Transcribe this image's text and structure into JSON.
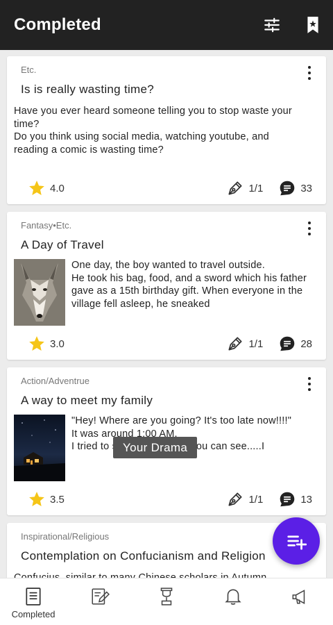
{
  "header": {
    "title": "Completed",
    "background": "#222222",
    "icons": [
      "tune-icon",
      "bookmark-icon"
    ]
  },
  "posts": [
    {
      "category": "Etc.",
      "title": "Is is really wasting time?",
      "excerpt": "Have you ever heard someone telling you to stop waste your time?\nDo you think using social media, watching youtube, and reading a comic is wasting time?",
      "rating": "4.0",
      "episodes": "1/1",
      "comments": "33"
    },
    {
      "category": "Fantasy•Etc.",
      "title": "A Day of Travel",
      "excerpt": "One day, the boy wanted to travel outside.\nHe took his bag, food, and a sword which his father gave as a 15th birthday gift. When everyone in the village fell asleep, he sneaked",
      "thumbnail": "wolf-image",
      "rating": "3.0",
      "episodes": "1/1",
      "comments": "28"
    },
    {
      "category": "Action/Adventrue",
      "title": "A way to meet my family",
      "excerpt": "\"Hey! Where are you going? It's too late now!!!!\"\nIt was around 1:00 AM.\nI tried to sneak out but as you can see.....I",
      "thumbnail": "night-house-image",
      "rating": "3.5",
      "episodes": "1/1",
      "comments": "13"
    },
    {
      "category": "Inspirational/Religious",
      "title": "Contemplation on Confucianism and Religion",
      "excerpt": "Confucius, similar to many Chinese scholars in Autumn"
    }
  ],
  "overlay_chip": "Your Drama",
  "fab": {
    "icon": "add-to-list-icon",
    "color": "#5b1fe6"
  },
  "star_color": "#f5c518",
  "bottom_nav": [
    {
      "label": "Completed",
      "icon": "document-icon",
      "active": true
    },
    {
      "label": "",
      "icon": "edit-icon"
    },
    {
      "label": "",
      "icon": "trophy-icon"
    },
    {
      "label": "",
      "icon": "bell-icon"
    },
    {
      "label": "",
      "icon": "megaphone-icon"
    }
  ]
}
